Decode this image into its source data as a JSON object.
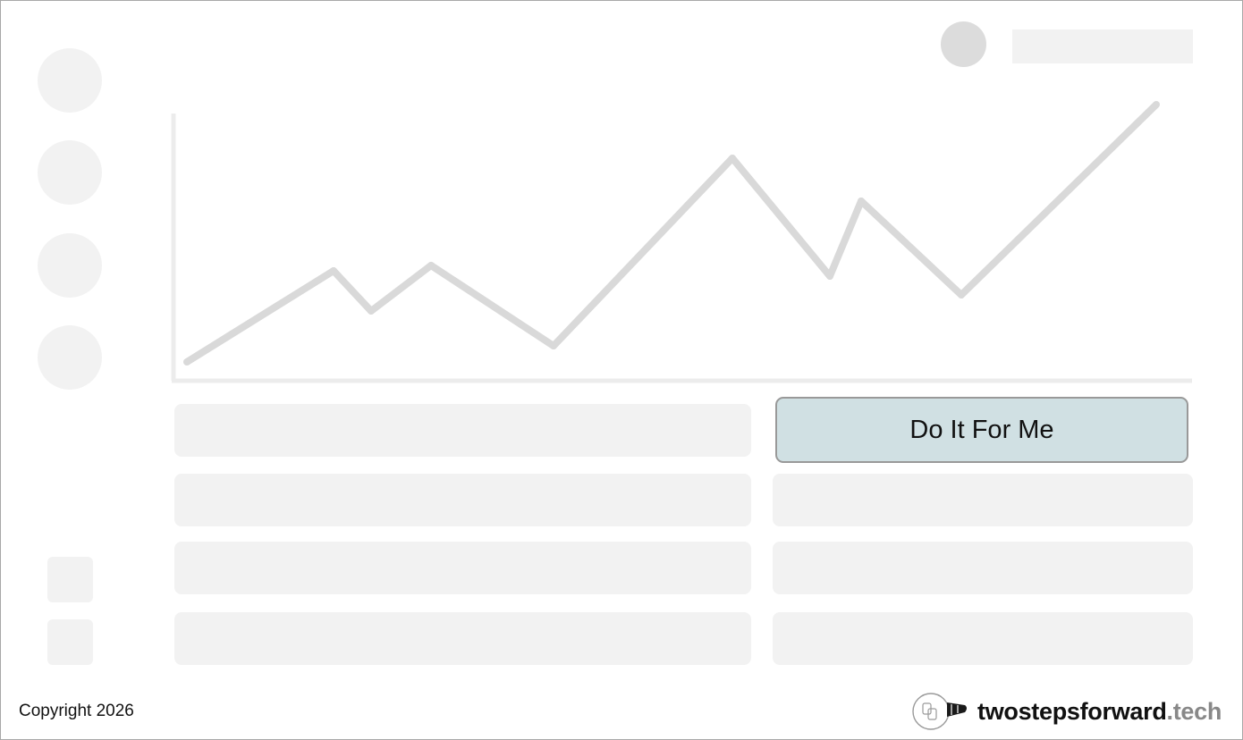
{
  "actions": {
    "do_it_for_me_label": "Do It For Me"
  },
  "footer": {
    "copyright": "Copyright 2026",
    "brand_name": "twostepsforward",
    "brand_tld": ".tech"
  },
  "icons": {
    "sidebar_nav": [
      "nav-circle-icon",
      "nav-circle-icon",
      "nav-circle-icon",
      "nav-circle-icon"
    ],
    "sidebar_bottom": [
      "square-icon",
      "square-icon"
    ],
    "brand": "lightbulb-footsteps-icon"
  },
  "colors": {
    "placeholder": "#f2f2f2",
    "chart_line": "#d9d9d9",
    "cta_background": "#d0e0e3",
    "cta_border": "#999999",
    "brand_tld": "#888888"
  },
  "chart_data": {
    "type": "line",
    "title": "",
    "xlabel": "",
    "ylabel": "",
    "x": [
      0,
      1,
      2,
      3,
      4,
      5,
      6,
      7,
      8,
      9,
      10
    ],
    "series": [
      {
        "values": [
          3,
          37,
          22,
          39,
          9,
          79,
          35,
          63,
          28,
          99
        ]
      }
    ],
    "ylim": [
      0,
      100
    ],
    "grid": false,
    "legend": "none"
  }
}
